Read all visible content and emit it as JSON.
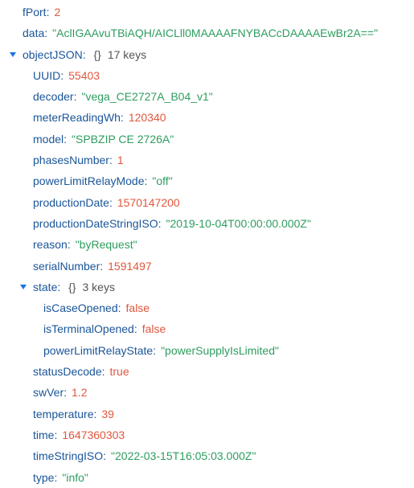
{
  "root": [
    {
      "key": "fPort",
      "value": "2",
      "type": "num"
    },
    {
      "key": "data",
      "value": "\"AclIGAAvuTBiAQH/AICLll0MAAAAFNYBACcDAAAAEwBr2A==\"",
      "type": "str"
    }
  ],
  "objectJSON": {
    "key": "objectJSON",
    "brace": "{}",
    "count": "17 keys",
    "children_before": [
      {
        "key": "UUID",
        "value": "55403",
        "type": "num"
      },
      {
        "key": "decoder",
        "value": "\"vega_CE2727A_B04_v1\"",
        "type": "str"
      },
      {
        "key": "meterReadingWh",
        "value": "120340",
        "type": "num"
      },
      {
        "key": "model",
        "value": "\"SPBZIP CE 2726A\"",
        "type": "str"
      },
      {
        "key": "phasesNumber",
        "value": "1",
        "type": "num"
      },
      {
        "key": "powerLimitRelayMode",
        "value": "\"off\"",
        "type": "str"
      },
      {
        "key": "productionDate",
        "value": "1570147200",
        "type": "num"
      },
      {
        "key": "productionDateStringISO",
        "value": "\"2019-10-04T00:00:00.000Z\"",
        "type": "str"
      },
      {
        "key": "reason",
        "value": "\"byRequest\"",
        "type": "str"
      },
      {
        "key": "serialNumber",
        "value": "1591497",
        "type": "num"
      }
    ],
    "state": {
      "key": "state",
      "brace": "{}",
      "count": "3 keys",
      "children": [
        {
          "key": "isCaseOpened",
          "value": "false",
          "type": "bool"
        },
        {
          "key": "isTerminalOpened",
          "value": "false",
          "type": "bool"
        },
        {
          "key": "powerLimitRelayState",
          "value": "\"powerSupplyIsLimited\"",
          "type": "str"
        }
      ]
    },
    "children_after": [
      {
        "key": "statusDecode",
        "value": "true",
        "type": "bool"
      },
      {
        "key": "swVer",
        "value": "1.2",
        "type": "num"
      },
      {
        "key": "temperature",
        "value": "39",
        "type": "num"
      },
      {
        "key": "time",
        "value": "1647360303",
        "type": "num"
      },
      {
        "key": "timeStringISO",
        "value": "\"2022-03-15T16:05:03.000Z\"",
        "type": "str"
      },
      {
        "key": "type",
        "value": "\"info\"",
        "type": "str"
      }
    ]
  },
  "colors": {
    "key": "#1a5599",
    "string": "#2e9d5f",
    "number": "#e0573f",
    "toggle": "#1a73e8"
  },
  "icons": {
    "expanded": "caret-down-icon"
  }
}
